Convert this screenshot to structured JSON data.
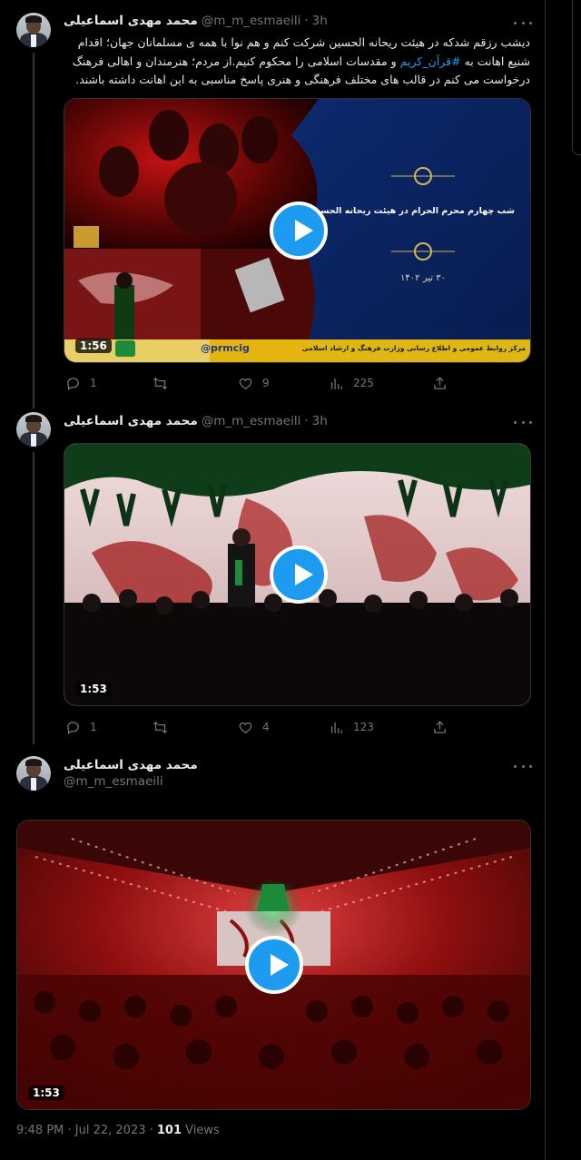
{
  "tweets": [
    {
      "name": "محمد مهدی اسماعیلی",
      "handle": "@m_m_esmaeili",
      "time": "3h",
      "text_before": "دیشب رزقم شدکه در هیئت ریحانه الحسین شرکت کنم و هم نوا با همه ی مسلمانان جهان؛ اقدام شنیع اهانت به ",
      "hashtag": "#قرآن_کریم",
      "text_after": " و مقدسات اسلامی را محکوم کنیم.از مردم؛ هنرمندان و اهالی فرهنگ درخواست می کنم در قالب های مختلف فرهنگی و هنری پاسخ مناسبی به این اهانت داشته باشند.",
      "video": {
        "duration": "1:56",
        "caption_title": "شب چهارم محرم الحرام در هیئت ریحانه الحسین",
        "caption_date": "۳۰ تیر ۱۴۰۲",
        "credit_handle": "@prmcig",
        "credit_text": "مرکز روابط عمومی و اطلاع رسانی وزارت فرهنگ و ارشاد اسلامی"
      },
      "stats": {
        "replies": "1",
        "retweets": "",
        "likes": "9",
        "views": "225"
      }
    },
    {
      "name": "محمد مهدی اسماعیلی",
      "handle": "@m_m_esmaeili",
      "time": "3h",
      "video": {
        "duration": "1:53"
      },
      "stats": {
        "replies": "1",
        "retweets": "",
        "likes": "4",
        "views": "123"
      }
    },
    {
      "name": "محمد مهدی اسماعیلی",
      "handle": "@m_m_esmaeili",
      "video": {
        "duration": "1:53"
      }
    }
  ],
  "footer": {
    "timestamp": "9:48 PM · Jul 22, 2023 · ",
    "views_count": "101",
    "views_label": " Views"
  },
  "icons": [
    "more-icon",
    "reply-icon",
    "retweet-icon",
    "like-icon",
    "views-icon",
    "share-icon",
    "play-icon"
  ],
  "colors": {
    "accent": "#1d9bf0",
    "secondary_text": "#71767b",
    "primary_text": "#e7e9ea",
    "background": "#000000"
  }
}
